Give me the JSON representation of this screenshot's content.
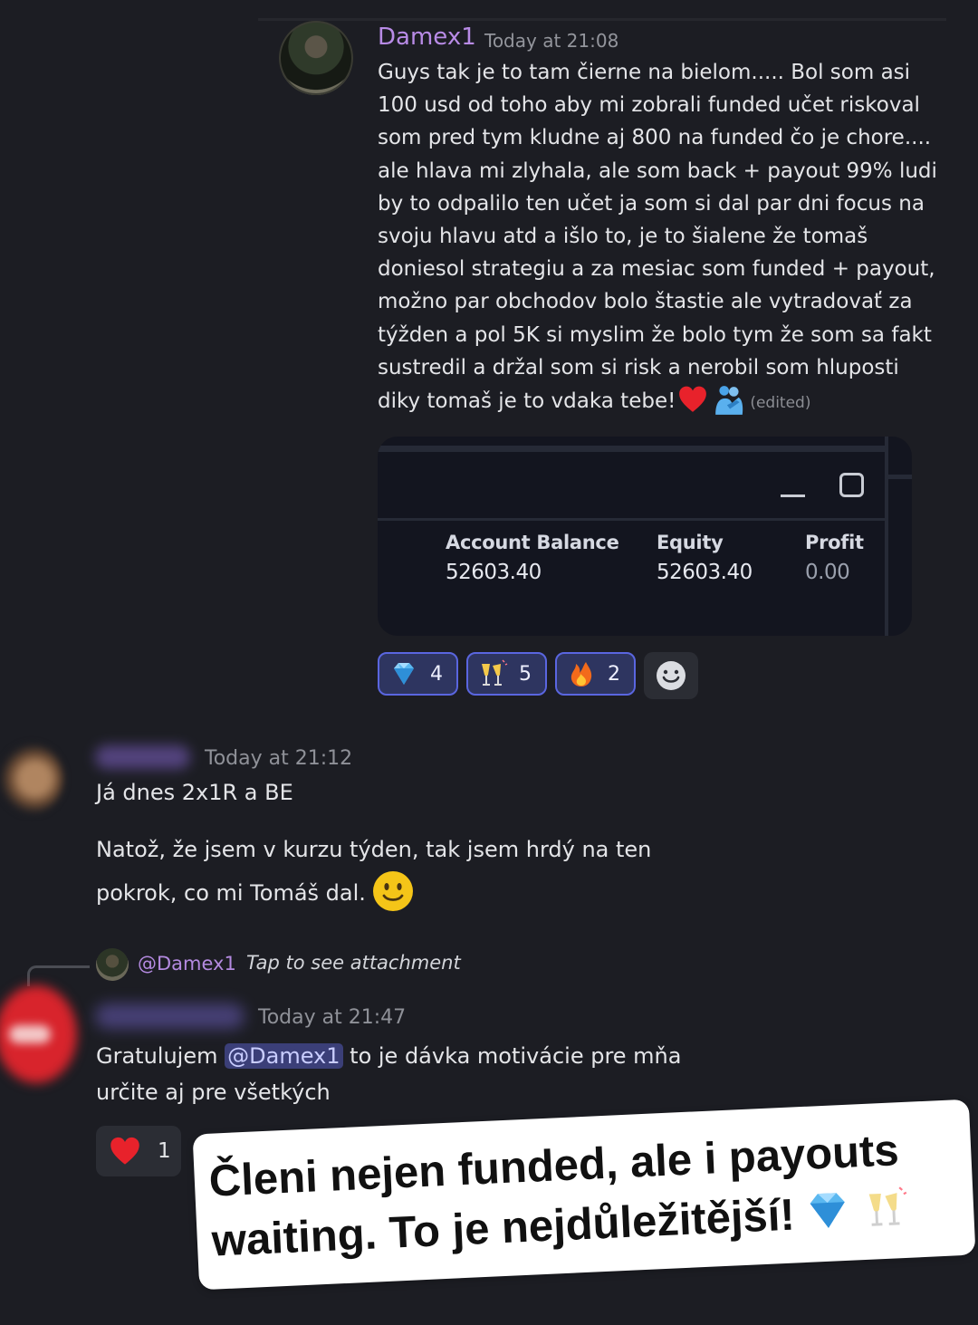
{
  "message1": {
    "author": "Damex1",
    "timestamp": "Today at 21:08",
    "lines": [
      "Guys tak je to tam čierne na bielom..... Bol som asi",
      "100 usd od toho aby mi zobrali funded učet riskoval",
      "som pred tym kludne aj 800 na funded čo je chore....",
      "ale hlava mi zlyhala, ale som back + payout 99% ludi",
      "by to odpalilo ten učet ja som si dal par dni focus na",
      "svoju hlavu atd a išlo to, je to šialene že tomaš",
      "doniesol strategiu a za mesiac som funded + payout,",
      "možno par obchodov bolo štastie ale vytradovať za",
      "týžden a pol 5K si myslim že bolo tym že som sa fakt",
      "sustredil a držal som si risk a nerobil som hluposti",
      "diky tomaš je to vdaka tebe!"
    ],
    "emojis": [
      "red-heart-icon",
      "hugging-people-icon"
    ],
    "edited_label": "(edited)"
  },
  "attachment": {
    "columns": [
      {
        "label": "Account Balance",
        "value": "52603.40"
      },
      {
        "label": "Equity",
        "value": "52603.40"
      },
      {
        "label": "Profit",
        "value": "0.00"
      }
    ]
  },
  "reactions1": [
    {
      "icon": "gem-icon",
      "count": "4"
    },
    {
      "icon": "champagne-icon",
      "count": "5"
    },
    {
      "icon": "fire-icon",
      "count": "2"
    }
  ],
  "message2": {
    "timestamp": "Today at 21:12",
    "line1": "Já dnes 2x1R a BE",
    "line2": "Natož, že jsem v kurzu týden, tak jsem hrdý na ten",
    "line3": "pokrok, co mi Tomáš dal."
  },
  "reply": {
    "mention": "@Damex1",
    "text": "Tap to see attachment"
  },
  "message3": {
    "timestamp": "Today at 21:47",
    "prefix": "Gratulujem",
    "mention": "@Damex1",
    "suffix": "to je dávka motivácie pre mňa",
    "line2": "určite aj pre všetkých"
  },
  "reactions3": [
    {
      "icon": "red-heart-icon",
      "count": "1"
    }
  ],
  "sticker": {
    "line1": "Členi nejen funded, ale i payouts",
    "line2": "waiting. To je nejdůležitější!"
  },
  "colors": {
    "background": "#1c1d23",
    "author_name": "#b88be6",
    "mention_bg": "#3b3f78",
    "reaction_active_border": "#5a66e0"
  }
}
